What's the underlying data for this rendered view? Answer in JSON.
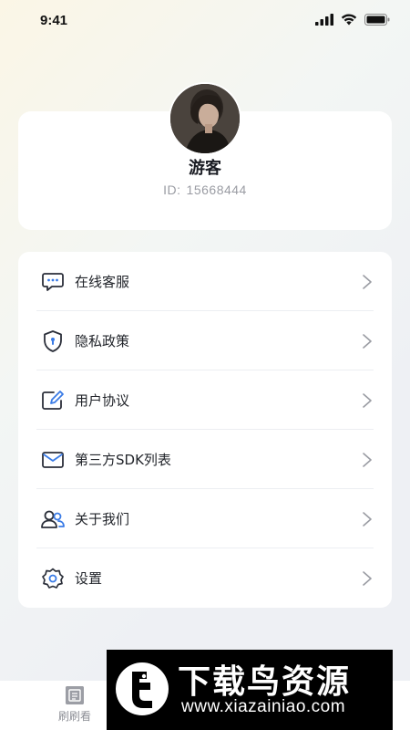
{
  "status_bar": {
    "time": "9:41"
  },
  "profile": {
    "nickname": "游客",
    "id_label": "ID:",
    "id_value": "15668444"
  },
  "menu": {
    "items": [
      {
        "label": "在线客服",
        "icon": "chat-icon"
      },
      {
        "label": "隐私政策",
        "icon": "shield-icon"
      },
      {
        "label": "用户协议",
        "icon": "edit-document-icon"
      },
      {
        "label": "第三方SDK列表",
        "icon": "envelope-icon"
      },
      {
        "label": "关于我们",
        "icon": "users-icon"
      },
      {
        "label": "设置",
        "icon": "gear-icon"
      }
    ]
  },
  "tabbar": {
    "tabs": [
      {
        "label": "刷刷看"
      }
    ]
  },
  "watermark": {
    "title": "下载鸟资源",
    "url": "www.xiazainiao.com"
  },
  "colors": {
    "accent": "#2a5bd7",
    "text_primary": "#1b1d24",
    "text_secondary": "#9a9ca3",
    "icon_stroke": "#2b2f3a",
    "icon_accent": "#3a7be6"
  }
}
